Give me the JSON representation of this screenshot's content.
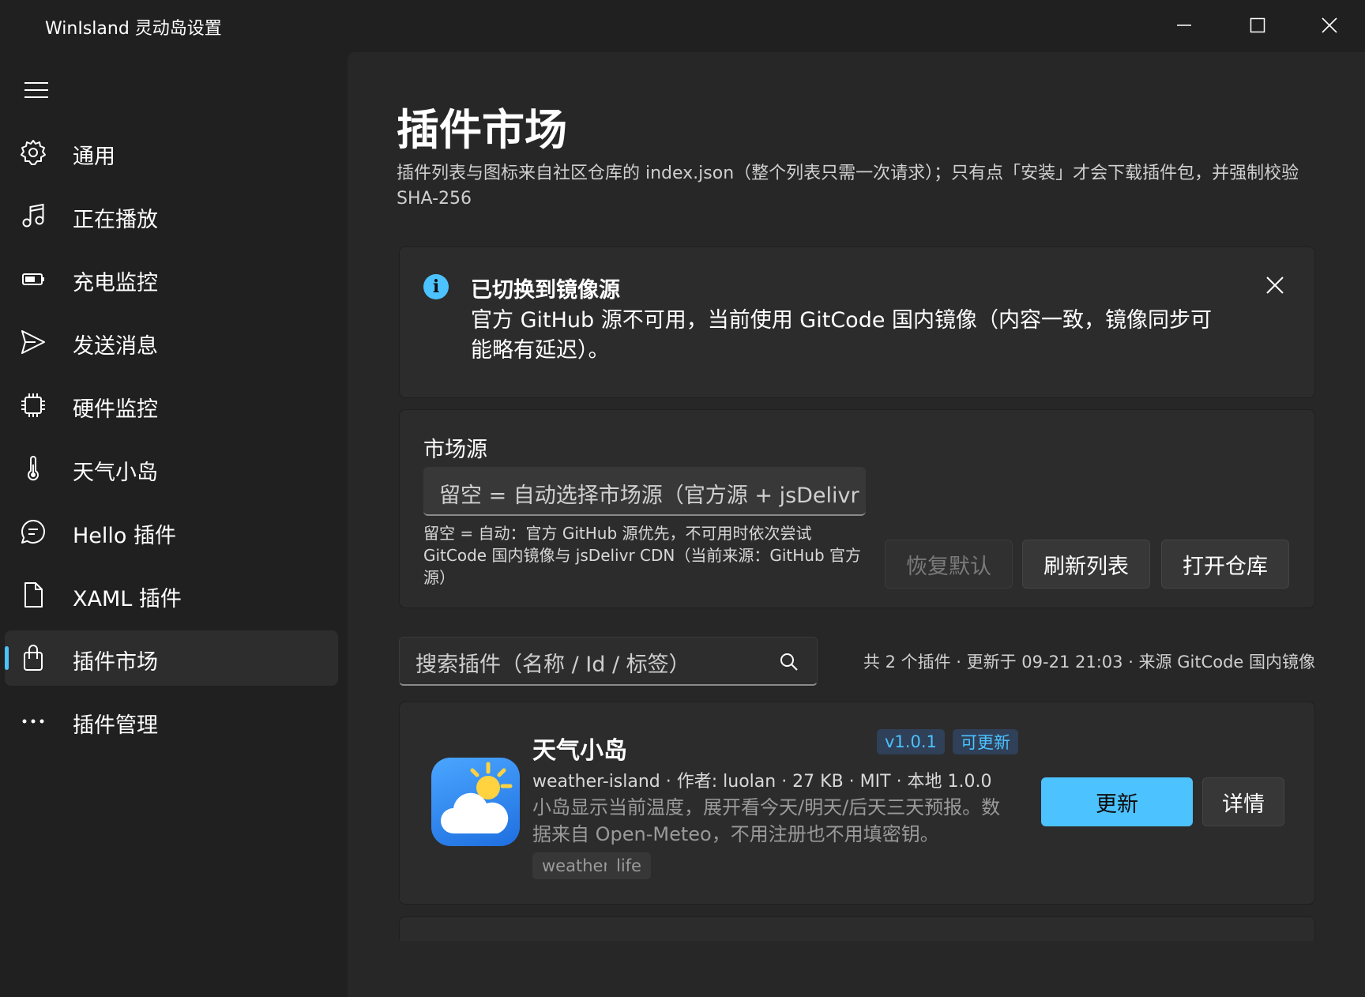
{
  "window": {
    "title": "WinIsland  灵动岛设置"
  },
  "sidebar": {
    "items": [
      {
        "label": "通用"
      },
      {
        "label": "正在播放"
      },
      {
        "label": "充电监控"
      },
      {
        "label": "发送消息"
      },
      {
        "label": "硬件监控"
      },
      {
        "label": "天气小岛"
      },
      {
        "label": "Hello 插件"
      },
      {
        "label": "XAML 插件"
      },
      {
        "label": "插件市场"
      },
      {
        "label": "插件管理"
      }
    ]
  },
  "page": {
    "title": "插件市场",
    "description": "插件列表与图标来自社区仓库的 index.json（整个列表只需一次请求）；只有点「安装」才会下载插件包，并强制校验 SHA-256"
  },
  "info_bar": {
    "title": "已切换到镜像源",
    "message": "官方 GitHub 源不可用，当前使用 GitCode 国内镜像（内容一致，镜像同步可能略有延迟）。"
  },
  "market_source": {
    "label": "市场源",
    "placeholder": "留空 = 自动选择市场源（官方源 + jsDelivr 镜像）",
    "hint": "留空 = 自动：官方 GitHub 源优先，不可用时依次尝试 GitCode 国内镜像与 jsDelivr CDN（当前来源：GitHub 官方源）",
    "buttons": {
      "reset": "恢复默认",
      "refresh": "刷新列表",
      "open_repo": "打开仓库"
    }
  },
  "search": {
    "placeholder": "搜索插件（名称 / Id / 标签）"
  },
  "status": "共 2 个插件 · 更新于 09-21 21:03 · 来源 GitCode 国内镜像",
  "plugins": [
    {
      "name": "天气小岛",
      "version_badge": "v1.0.1",
      "update_badge": "可更新",
      "meta": "weather-island · 作者: luolan · 27 KB · MIT · 本地 1.0.0",
      "description": "小岛显示当前温度，展开看今天/明天/后天三天预报。数据来自 Open-Meteo，不用注册也不用填密钥。",
      "tags": [
        "weather",
        "life"
      ],
      "buttons": {
        "update": "更新",
        "details": "详情"
      }
    }
  ],
  "colors": {
    "accent": "#4cc2ff",
    "background": "#202020",
    "card": "#2c2c2c"
  }
}
